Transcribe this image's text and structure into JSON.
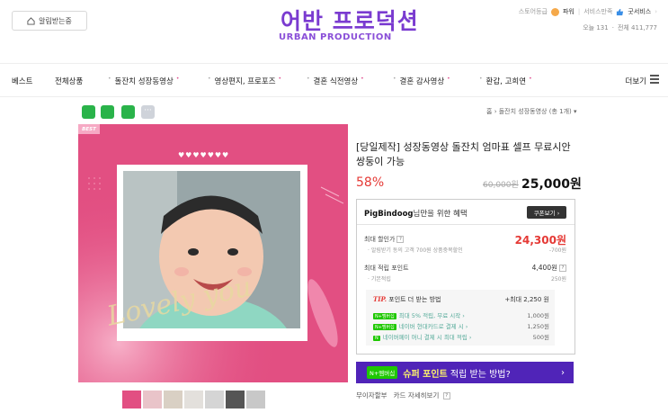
{
  "header": {
    "notify_label": "알림받는중",
    "logo_kr": "어반 프로덕션",
    "logo_en": "URBAN PRODUCTION",
    "top_links": {
      "store_level": "스토어등급",
      "power": "파워",
      "service_satisfaction": "서비스만족",
      "good_service": "굿서비스"
    },
    "visitors": {
      "today": "오늘 131",
      "total": "전체 411,777"
    }
  },
  "nav": {
    "items": [
      "베스트",
      "전체상품",
      "돌잔치 성장동영상",
      "영상편지, 프로포즈",
      "결혼 식전영상",
      "결혼 감사영상",
      "환갑, 고희연"
    ],
    "more": "더보기"
  },
  "breadcrumb": {
    "home": "홈",
    "separator": "›",
    "category": "돌잔치 성장동영상",
    "count": "(총 1개)"
  },
  "product": {
    "best_badge": "BEST",
    "hearts": "♥♥♥♥♥♥♥",
    "script_text": "Lovely you",
    "title": "[당일제작] 성장동영상 돌잔치 엄마표 셀프 무료시안 쌍둥이 가능",
    "discount": "58%",
    "original_price": "60,000원",
    "price": "25,000원"
  },
  "benefit": {
    "user": "PigBindoog",
    "head_suffix": "님만을 위한 혜택",
    "coupon_button": "쿠폰보기 ›",
    "max_discount_label": "최대 할인가",
    "max_discount_value": "24,300원",
    "max_discount_sub": "알림받기 동의 고객 700원 상품중복할인",
    "max_discount_sub_value": "-700원",
    "max_points_label": "최대 적립 포인트",
    "max_points_value": "4,400원",
    "basic_points_label": "기본적립",
    "basic_points_value": "250원",
    "tip_label": "TIP.",
    "tip_title": "포인트 더 받는 방법",
    "tip_total": "+최대 2,250 원",
    "tip_rows": [
      {
        "badge": "N+멤버십",
        "text": "최대 5% 적립, 무료 시작 ›",
        "value": "1,000원"
      },
      {
        "badge": "N+멤버십",
        "text": "네이버 현대카드로 결제 시 ›",
        "value": "1,250원"
      },
      {
        "badge": "N",
        "text": "네이버페이 머니 결제 시 최대 적립 ›",
        "value": "500원"
      }
    ]
  },
  "super_banner": {
    "badge": "N+멤버십",
    "prefix": "슈퍼 포인트",
    "suffix": " 적립 받는 방법?",
    "arrow": "›"
  },
  "bottom_info": {
    "installment": "무이자할부",
    "card_info": "카드 자세히보기"
  },
  "colors": {
    "brand": "#7a3bd0",
    "hero_pink": "#e24f82",
    "price_red": "#e53935",
    "banner_purple": "#5024b8",
    "naver_green": "#1ec800"
  }
}
